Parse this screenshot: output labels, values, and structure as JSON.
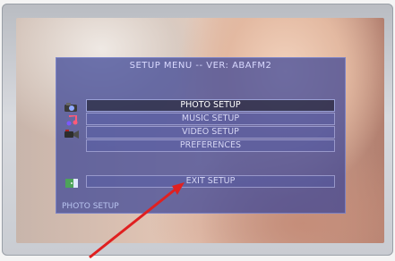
{
  "menu": {
    "title": "SETUP MENU -- VER: ABAFM2",
    "items": [
      {
        "label": "PHOTO SETUP",
        "icon": "camera-icon",
        "selected": true
      },
      {
        "label": "MUSIC SETUP",
        "icon": "music-note-icon",
        "selected": false
      },
      {
        "label": "VIDEO SETUP",
        "icon": "video-camera-icon",
        "selected": false
      },
      {
        "label": "PREFERENCES",
        "icon": "",
        "selected": false
      }
    ],
    "exit": {
      "label": "EXIT SETUP",
      "icon": "exit-door-icon"
    },
    "status": "PHOTO SETUP"
  },
  "colors": {
    "panel": "#3a4496",
    "selected_row": "#14141e",
    "text": "#d6d6f4",
    "pointer_arrow": "#e02020"
  }
}
